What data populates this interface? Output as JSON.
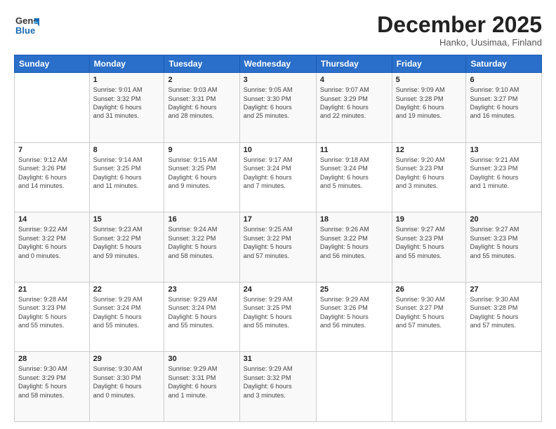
{
  "header": {
    "logo_line1": "General",
    "logo_line2": "Blue",
    "month_title": "December 2025",
    "subtitle": "Hanko, Uusimaa, Finland"
  },
  "weekdays": [
    "Sunday",
    "Monday",
    "Tuesday",
    "Wednesday",
    "Thursday",
    "Friday",
    "Saturday"
  ],
  "weeks": [
    [
      {
        "day": "",
        "info": ""
      },
      {
        "day": "1",
        "info": "Sunrise: 9:01 AM\nSunset: 3:32 PM\nDaylight: 6 hours\nand 31 minutes."
      },
      {
        "day": "2",
        "info": "Sunrise: 9:03 AM\nSunset: 3:31 PM\nDaylight: 6 hours\nand 28 minutes."
      },
      {
        "day": "3",
        "info": "Sunrise: 9:05 AM\nSunset: 3:30 PM\nDaylight: 6 hours\nand 25 minutes."
      },
      {
        "day": "4",
        "info": "Sunrise: 9:07 AM\nSunset: 3:29 PM\nDaylight: 6 hours\nand 22 minutes."
      },
      {
        "day": "5",
        "info": "Sunrise: 9:09 AM\nSunset: 3:28 PM\nDaylight: 6 hours\nand 19 minutes."
      },
      {
        "day": "6",
        "info": "Sunrise: 9:10 AM\nSunset: 3:27 PM\nDaylight: 6 hours\nand 16 minutes."
      }
    ],
    [
      {
        "day": "7",
        "info": "Sunrise: 9:12 AM\nSunset: 3:26 PM\nDaylight: 6 hours\nand 14 minutes."
      },
      {
        "day": "8",
        "info": "Sunrise: 9:14 AM\nSunset: 3:25 PM\nDaylight: 6 hours\nand 11 minutes."
      },
      {
        "day": "9",
        "info": "Sunrise: 9:15 AM\nSunset: 3:25 PM\nDaylight: 6 hours\nand 9 minutes."
      },
      {
        "day": "10",
        "info": "Sunrise: 9:17 AM\nSunset: 3:24 PM\nDaylight: 6 hours\nand 7 minutes."
      },
      {
        "day": "11",
        "info": "Sunrise: 9:18 AM\nSunset: 3:24 PM\nDaylight: 6 hours\nand 5 minutes."
      },
      {
        "day": "12",
        "info": "Sunrise: 9:20 AM\nSunset: 3:23 PM\nDaylight: 6 hours\nand 3 minutes."
      },
      {
        "day": "13",
        "info": "Sunrise: 9:21 AM\nSunset: 3:23 PM\nDaylight: 6 hours\nand 1 minute."
      }
    ],
    [
      {
        "day": "14",
        "info": "Sunrise: 9:22 AM\nSunset: 3:22 PM\nDaylight: 6 hours\nand 0 minutes."
      },
      {
        "day": "15",
        "info": "Sunrise: 9:23 AM\nSunset: 3:22 PM\nDaylight: 5 hours\nand 59 minutes."
      },
      {
        "day": "16",
        "info": "Sunrise: 9:24 AM\nSunset: 3:22 PM\nDaylight: 5 hours\nand 58 minutes."
      },
      {
        "day": "17",
        "info": "Sunrise: 9:25 AM\nSunset: 3:22 PM\nDaylight: 5 hours\nand 57 minutes."
      },
      {
        "day": "18",
        "info": "Sunrise: 9:26 AM\nSunset: 3:22 PM\nDaylight: 5 hours\nand 56 minutes."
      },
      {
        "day": "19",
        "info": "Sunrise: 9:27 AM\nSunset: 3:23 PM\nDaylight: 5 hours\nand 55 minutes."
      },
      {
        "day": "20",
        "info": "Sunrise: 9:27 AM\nSunset: 3:23 PM\nDaylight: 5 hours\nand 55 minutes."
      }
    ],
    [
      {
        "day": "21",
        "info": "Sunrise: 9:28 AM\nSunset: 3:23 PM\nDaylight: 5 hours\nand 55 minutes."
      },
      {
        "day": "22",
        "info": "Sunrise: 9:29 AM\nSunset: 3:24 PM\nDaylight: 5 hours\nand 55 minutes."
      },
      {
        "day": "23",
        "info": "Sunrise: 9:29 AM\nSunset: 3:24 PM\nDaylight: 5 hours\nand 55 minutes."
      },
      {
        "day": "24",
        "info": "Sunrise: 9:29 AM\nSunset: 3:25 PM\nDaylight: 5 hours\nand 55 minutes."
      },
      {
        "day": "25",
        "info": "Sunrise: 9:29 AM\nSunset: 3:26 PM\nDaylight: 5 hours\nand 56 minutes."
      },
      {
        "day": "26",
        "info": "Sunrise: 9:30 AM\nSunset: 3:27 PM\nDaylight: 5 hours\nand 57 minutes."
      },
      {
        "day": "27",
        "info": "Sunrise: 9:30 AM\nSunset: 3:28 PM\nDaylight: 5 hours\nand 57 minutes."
      }
    ],
    [
      {
        "day": "28",
        "info": "Sunrise: 9:30 AM\nSunset: 3:29 PM\nDaylight: 5 hours\nand 58 minutes."
      },
      {
        "day": "29",
        "info": "Sunrise: 9:30 AM\nSunset: 3:30 PM\nDaylight: 6 hours\nand 0 minutes."
      },
      {
        "day": "30",
        "info": "Sunrise: 9:29 AM\nSunset: 3:31 PM\nDaylight: 6 hours\nand 1 minute."
      },
      {
        "day": "31",
        "info": "Sunrise: 9:29 AM\nSunset: 3:32 PM\nDaylight: 6 hours\nand 3 minutes."
      },
      {
        "day": "",
        "info": ""
      },
      {
        "day": "",
        "info": ""
      },
      {
        "day": "",
        "info": ""
      }
    ]
  ]
}
